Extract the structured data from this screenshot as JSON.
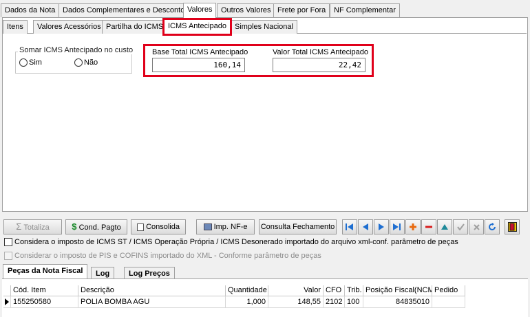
{
  "main_tabs": [
    "Dados da Nota",
    "Dados Complementares e Desconto",
    "Valores",
    "Outros Valores",
    "Frete por Fora",
    "NF Complementar"
  ],
  "sub_tabs": [
    "Itens",
    "Valores Acessórios",
    "Partilha do ICMS",
    "ICMS Antecipado",
    "Simples Nacional"
  ],
  "icms": {
    "group_label": "Somar ICMS Antecipado no custo",
    "option_sim": "Sim",
    "option_nao": "Não",
    "base_label": "Base Total ICMS Antecipado",
    "base_value": "160,14",
    "valor_label": "Valor Total ICMS Antecipado",
    "valor_value": "22,42"
  },
  "toolbar": {
    "totaliza": "Totaliza",
    "cond_pagto": "Cond. Pagto",
    "consolida": "Consolida",
    "imp_nfe": "Imp. NF-e",
    "consulta_fechamento": "Consulta Fechamento"
  },
  "options": {
    "check1": "Considera o imposto de ICMS ST / ICMS Operação Própria / ICMS Desonerado importado do arquivo xml-conf. parâmetro de peças",
    "check2": "Considerar o imposto de PIS e COFINS importado do XML - Conforme parâmetro de peças"
  },
  "bottom_tabs": [
    "Peças da Nota Fiscal",
    "Log",
    "Log Preços"
  ],
  "grid": {
    "columns": [
      "Cód. Item",
      "Descrição",
      "Quantidade",
      "Valor",
      "CFO",
      "Trib.",
      "Posição Fiscal(NCM)",
      "Pedido"
    ],
    "rows": [
      [
        "155250580",
        "POLIA BOMBA AGU",
        "1,000",
        "148,55",
        "2102",
        "100",
        "84835010",
        ""
      ]
    ]
  },
  "colors": {
    "highlight": "#e0001a",
    "nav_blue": "#1f6fd1",
    "add_orange": "#e86a10",
    "remove_red": "#d81e1e",
    "money_green": "#1a8a2a"
  }
}
